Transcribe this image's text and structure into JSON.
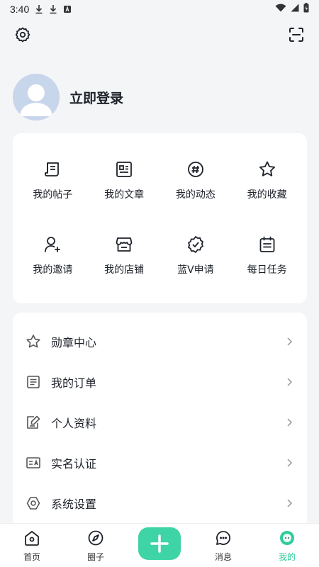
{
  "status_bar": {
    "time": "3:40"
  },
  "profile": {
    "login_label": "立即登录"
  },
  "grid": [
    {
      "label": "我的帖子",
      "icon": "post-icon"
    },
    {
      "label": "我的文章",
      "icon": "article-icon"
    },
    {
      "label": "我的动态",
      "icon": "hashtag-icon"
    },
    {
      "label": "我的收藏",
      "icon": "star-icon"
    },
    {
      "label": "我的邀请",
      "icon": "invite-user-icon"
    },
    {
      "label": "我的店铺",
      "icon": "store-icon"
    },
    {
      "label": "蓝V申请",
      "icon": "verified-badge-icon"
    },
    {
      "label": "每日任务",
      "icon": "calendar-task-icon"
    }
  ],
  "list": [
    {
      "label": "勋章中心",
      "icon": "medal-star-icon"
    },
    {
      "label": "我的订单",
      "icon": "order-icon"
    },
    {
      "label": "个人资料",
      "icon": "edit-profile-icon"
    },
    {
      "label": "实名认证",
      "icon": "id-card-icon"
    },
    {
      "label": "系统设置",
      "icon": "settings-icon"
    }
  ],
  "tabs": [
    {
      "label": "首页",
      "icon": "home-icon"
    },
    {
      "label": "圈子",
      "icon": "compass-icon"
    },
    {
      "label": "",
      "icon": "plus-icon"
    },
    {
      "label": "消息",
      "icon": "chat-icon"
    },
    {
      "label": "我的",
      "icon": "profile-face-icon"
    }
  ],
  "colors": {
    "accent": "#3ed4a5",
    "active_tab": "#2fcc9b",
    "background": "#f4f5f7",
    "card": "#ffffff"
  }
}
